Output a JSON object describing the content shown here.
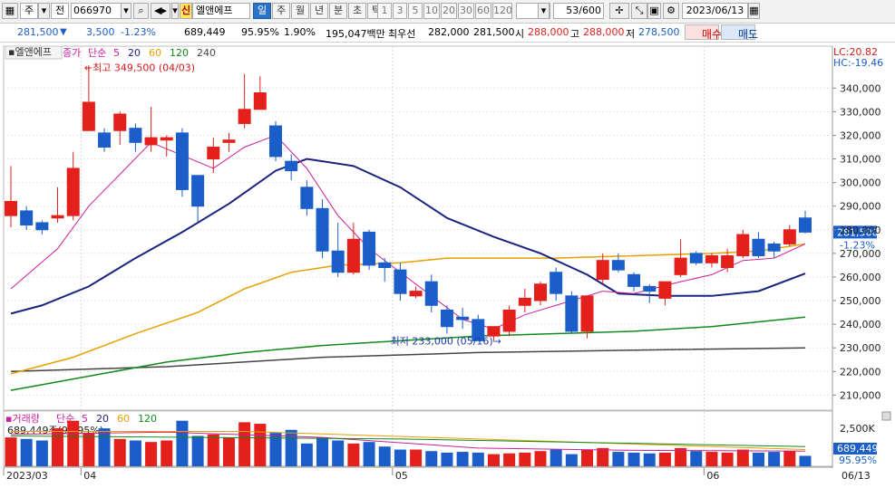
{
  "toolbar": {
    "market": "주",
    "mode": "전",
    "code": "066970",
    "new_badge": "신",
    "stock_name": "엘앤에프",
    "periods": [
      "일",
      "주",
      "월",
      "년",
      "분",
      "초",
      "틱"
    ],
    "active_period": "일",
    "intervals": [
      "1",
      "3",
      "5",
      "10",
      "20",
      "30",
      "60",
      "120"
    ],
    "count": "53/600",
    "date": "2023/06/13"
  },
  "quote": {
    "price": "281,500",
    "change": "3,500",
    "change_pct": "-1.23%",
    "volume": "689,449",
    "vol_ratio": "95.95%",
    "turnover": "1.90%",
    "amount": "195,047백만",
    "best_label": "최우선",
    "best_ask": "282,000",
    "best_bid": "281,500",
    "open_label": "시",
    "open": "288,000",
    "high_label": "고",
    "high": "288,000",
    "low_label": "저",
    "low": "278,500",
    "buy_label": "매수",
    "sell_label": "매도"
  },
  "chart_data": {
    "type": "candlestick",
    "stock_name": "엘앤에프",
    "legend": {
      "close_label": "종가",
      "ma_label": "단순",
      "periods": [
        "5",
        "20",
        "60",
        "120",
        "240"
      ]
    },
    "period_colors": {
      "5": "#cc1f9a",
      "20": "#1a237e",
      "60": "#e6a100",
      "120": "#118a1c",
      "240": "#444444"
    },
    "up_color": "#e3201b",
    "down_color": "#1b5ec9",
    "y_ticks": [
      210000,
      220000,
      230000,
      240000,
      250000,
      260000,
      270000,
      280000,
      290000,
      300000,
      310000,
      320000,
      330000,
      340000
    ],
    "ylim": [
      204000,
      352000
    ],
    "x_labels": [
      {
        "label": "2023/03",
        "idx": 0
      },
      {
        "label": "04",
        "idx": 5
      },
      {
        "label": "05",
        "idx": 25
      },
      {
        "label": "06",
        "idx": 45
      }
    ],
    "last_date_label": "06/13",
    "high_note": "최고 349,500 (04/03)",
    "high_idx": 5,
    "high_value": 349500,
    "low_note": "최저 233,000 (05/16)",
    "low_idx": 32,
    "low_value": 233000,
    "lc_label": "LC:20.82",
    "hc_label": "HC:-19.46",
    "price_tag": "281,500",
    "pct_tag": "-1.23%",
    "candles": [
      [
        286000,
        292000,
        307000,
        281000
      ],
      [
        288000,
        282000,
        290000,
        280000
      ],
      [
        283000,
        280000,
        284000,
        278000
      ],
      [
        285000,
        286000,
        298000,
        283000
      ],
      [
        286000,
        306000,
        313000,
        284000
      ],
      [
        322000,
        334000,
        349500,
        326000
      ],
      [
        321000,
        315000,
        323000,
        313000
      ],
      [
        322000,
        329000,
        330000,
        316000
      ],
      [
        323000,
        317000,
        325000,
        313000
      ],
      [
        316000,
        319000,
        332000,
        313000
      ],
      [
        318000,
        319000,
        320000,
        311000
      ],
      [
        321000,
        297000,
        323000,
        294000
      ],
      [
        303000,
        290000,
        303000,
        283000
      ],
      [
        310000,
        315000,
        319000,
        304000
      ],
      [
        317000,
        318000,
        321000,
        313000
      ],
      [
        325000,
        331000,
        346000,
        323000
      ],
      [
        331000,
        338000,
        345000,
        331000
      ],
      [
        324000,
        311000,
        326000,
        309000
      ],
      [
        309000,
        305000,
        312000,
        301000
      ],
      [
        298000,
        289000,
        301000,
        286000
      ],
      [
        289000,
        271000,
        293000,
        268000
      ],
      [
        271000,
        262000,
        283000,
        260000
      ],
      [
        262000,
        276000,
        283000,
        261000
      ],
      [
        279000,
        265000,
        280000,
        263000
      ],
      [
        266000,
        264000,
        268000,
        258000
      ],
      [
        263000,
        253000,
        266000,
        250000
      ],
      [
        252000,
        254000,
        256000,
        251000
      ],
      [
        258000,
        248000,
        261000,
        245000
      ],
      [
        246000,
        239000,
        248000,
        236000
      ],
      [
        243000,
        242000,
        247000,
        238000
      ],
      [
        242000,
        233000,
        244000,
        233000
      ],
      [
        235000,
        239000,
        239000,
        233000
      ],
      [
        237000,
        246000,
        248000,
        235000
      ],
      [
        248000,
        251000,
        255000,
        245000
      ],
      [
        250000,
        257000,
        258000,
        248000
      ],
      [
        262000,
        253000,
        264000,
        250000
      ],
      [
        252000,
        237000,
        254000,
        236000
      ],
      [
        237000,
        252000,
        252000,
        234000
      ],
      [
        259000,
        267000,
        270000,
        257000
      ],
      [
        267000,
        263000,
        270000,
        262000
      ],
      [
        261000,
        256000,
        262000,
        254000
      ],
      [
        256000,
        254000,
        257000,
        249000
      ],
      [
        251000,
        258000,
        258000,
        248000
      ],
      [
        261000,
        268000,
        276000,
        260000
      ],
      [
        270000,
        266000,
        271000,
        265000
      ],
      [
        266000,
        269000,
        270000,
        264000
      ],
      [
        264000,
        269000,
        272000,
        262000
      ],
      [
        269000,
        278000,
        280000,
        268000
      ],
      [
        276000,
        269000,
        279000,
        268000
      ],
      [
        274000,
        271000,
        275000,
        268000
      ],
      [
        274000,
        280000,
        282000,
        273000
      ],
      [
        285000,
        279000,
        288000,
        278500
      ]
    ],
    "ma_lines": {
      "5": [
        [
          0,
          255000
        ],
        [
          3,
          272000
        ],
        [
          5,
          290000
        ],
        [
          9,
          317000
        ],
        [
          13,
          306000
        ],
        [
          15,
          315000
        ],
        [
          17,
          320000
        ],
        [
          19,
          306000
        ],
        [
          21,
          286000
        ],
        [
          23,
          272000
        ],
        [
          25,
          262000
        ],
        [
          27,
          252000
        ],
        [
          29,
          242000
        ],
        [
          31,
          238000
        ],
        [
          33,
          244000
        ],
        [
          35,
          248000
        ],
        [
          38,
          254000
        ],
        [
          40,
          253000
        ],
        [
          43,
          258000
        ],
        [
          45,
          261000
        ],
        [
          47,
          267000
        ],
        [
          49,
          268000
        ],
        [
          51,
          274000
        ]
      ],
      "20": [
        [
          0,
          244500
        ],
        [
          2,
          248000
        ],
        [
          5,
          256000
        ],
        [
          8,
          268000
        ],
        [
          11,
          279000
        ],
        [
          14,
          291000
        ],
        [
          17,
          305000
        ],
        [
          19,
          310000
        ],
        [
          22,
          307000
        ],
        [
          25,
          298000
        ],
        [
          28,
          285000
        ],
        [
          31,
          277000
        ],
        [
          34,
          270000
        ],
        [
          37,
          261000
        ],
        [
          39,
          253000
        ],
        [
          42,
          252000
        ],
        [
          45,
          252000
        ],
        [
          48,
          254000
        ],
        [
          51,
          261500
        ]
      ],
      "60": [
        [
          0,
          219000
        ],
        [
          4,
          226000
        ],
        [
          8,
          236000
        ],
        [
          12,
          245000
        ],
        [
          15,
          255000
        ],
        [
          18,
          262000
        ],
        [
          21,
          265000
        ],
        [
          25,
          266000
        ],
        [
          28,
          268000
        ],
        [
          31,
          268000
        ],
        [
          35,
          268000
        ],
        [
          40,
          269000
        ],
        [
          45,
          270000
        ],
        [
          48,
          271000
        ],
        [
          51,
          274000
        ]
      ],
      "120": [
        [
          0,
          212000
        ],
        [
          5,
          218000
        ],
        [
          10,
          224000
        ],
        [
          15,
          228000
        ],
        [
          20,
          231000
        ],
        [
          25,
          233000
        ],
        [
          30,
          235000
        ],
        [
          35,
          236000
        ],
        [
          40,
          237000
        ],
        [
          45,
          239000
        ],
        [
          51,
          243000
        ]
      ],
      "240": [
        [
          0,
          220000
        ],
        [
          10,
          222000
        ],
        [
          20,
          226000
        ],
        [
          30,
          228000
        ],
        [
          40,
          229000
        ],
        [
          51,
          230000
        ]
      ]
    },
    "volume_legend": {
      "label": "거래량",
      "ma_label": "단순",
      "periods": [
        "5",
        "20",
        "60",
        "120"
      ]
    },
    "volume_value_label": "689,449주(95.95%)",
    "volume_tick": "2,500K",
    "volume_tag": "689,449",
    "volume_pct_tag": "95.95%",
    "volume_max": 3400,
    "volume_bars": [
      1900,
      1800,
      1700,
      2500,
      3000,
      2200,
      2500,
      1800,
      1700,
      1600,
      1700,
      3000,
      2000,
      2100,
      1900,
      2900,
      2800,
      2200,
      2400,
      1500,
      1900,
      1700,
      1500,
      1600,
      1300,
      1100,
      1100,
      1000,
      900,
      950,
      900,
      800,
      850,
      900,
      1000,
      1100,
      800,
      1100,
      1200,
      950,
      900,
      850,
      900,
      1200,
      1000,
      950,
      900,
      1100,
      900,
      950,
      1000,
      689
    ]
  }
}
